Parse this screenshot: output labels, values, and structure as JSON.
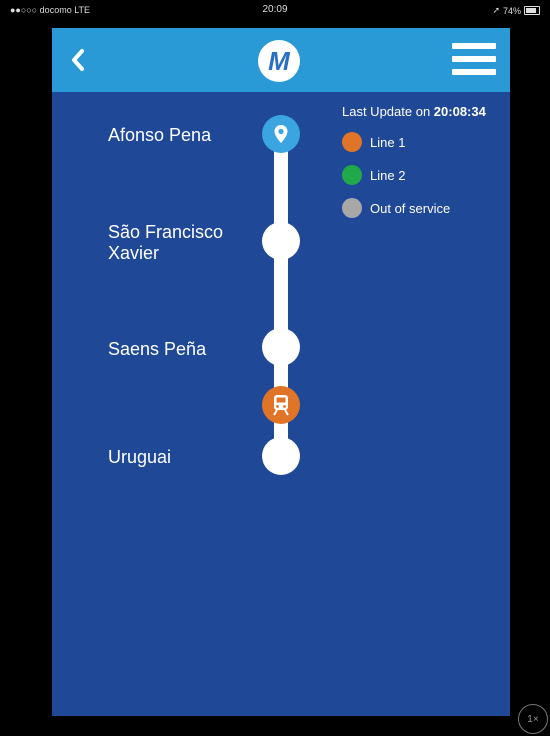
{
  "status_bar": {
    "carrier": "●●○○○ docomo  LTE",
    "time": "20:09",
    "battery": "74%"
  },
  "header": {
    "logo_text": "M",
    "back_icon": "chevron-left-icon",
    "menu_icon": "hamburger-menu-icon",
    "color": "#2a9ad6"
  },
  "stations": [
    {
      "name": "Afonso Pena",
      "marker": "location-pin-icon"
    },
    {
      "name": "São Francisco\nXavier"
    },
    {
      "name": "Saens Peña"
    },
    {
      "name": "Uruguai"
    }
  ],
  "train": {
    "icon": "train-icon",
    "line": "Line 1",
    "color": "#e07528"
  },
  "legend": {
    "last_update_prefix": "Last Update on ",
    "last_update_time": "20:08:34",
    "items": [
      {
        "label": "Line 1",
        "color": "#e07528"
      },
      {
        "label": "Line 2",
        "color": "#21a84a"
      },
      {
        "label": "Out of service",
        "color": "#a8a8a8"
      }
    ]
  },
  "zoom_indicator": "1×",
  "colors": {
    "background": "#1f4896",
    "track": "#ffffff"
  }
}
